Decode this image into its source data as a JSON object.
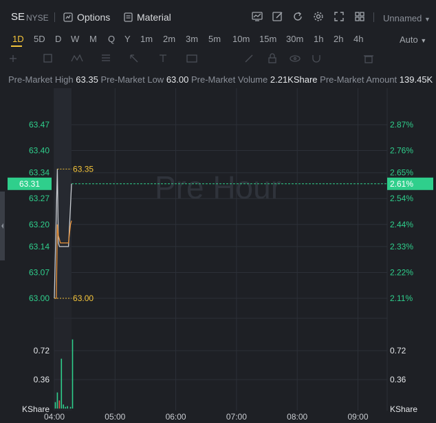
{
  "header": {
    "symbol": "SE",
    "exchange": "NYSE",
    "options_label": "Options",
    "material_label": "Material",
    "layout_name": "Unnamed"
  },
  "periods": [
    "1D",
    "5D",
    "D",
    "W",
    "M",
    "Q",
    "Y",
    "1m",
    "2m",
    "3m",
    "5m",
    "10m",
    "15m",
    "30m",
    "1h",
    "2h",
    "4h"
  ],
  "active_period": "1D",
  "scale_mode": "Auto",
  "stats": {
    "high_label": "Pre-Market High",
    "high_value": "63.35",
    "low_label": "Pre-Market Low",
    "low_value": "63.00",
    "volume_label": "Pre-Market Volume",
    "volume_value": "2.21KShare",
    "amount_label": "Pre-Market Amount",
    "amount_value": "139.45K"
  },
  "colors": {
    "up": "#2fcf8c",
    "price_line": "#c9ccd1",
    "avg_line": "#e8923a",
    "hl_marker": "#f5c53b",
    "grid": "#2c3038",
    "background": "#1e2025"
  },
  "chart_data": {
    "type": "line",
    "watermark": "Pre Hour",
    "x_ticks": [
      "04:00",
      "05:00",
      "06:00",
      "07:00",
      "08:00",
      "09:00"
    ],
    "y_ticks_price": [
      "63.47",
      "63.40",
      "63.34",
      "63.27",
      "63.20",
      "63.14",
      "63.07",
      "63.00"
    ],
    "y_ticks_pct": [
      "2.87%",
      "2.76%",
      "2.65%",
      "2.54%",
      "2.44%",
      "2.33%",
      "2.22%",
      "2.11%"
    ],
    "ylim": [
      63.0,
      63.47
    ],
    "current_price": "63.31",
    "current_pct": "2.61%",
    "high_marker": "63.35",
    "low_marker": "63.00",
    "series": [
      {
        "values_x": [
          0,
          3,
          4,
          5,
          7,
          9,
          11,
          14,
          16,
          17
        ],
        "values_y": [
          63.0,
          63.35,
          63.15,
          63.14,
          63.14,
          63.14,
          63.14,
          63.14,
          63.25,
          63.31
        ]
      },
      {
        "values_x": [
          0,
          2,
          3,
          4,
          6,
          8,
          10,
          12,
          14,
          16,
          17
        ],
        "values_y": [
          63.0,
          63.0,
          63.2,
          63.17,
          63.15,
          63.15,
          63.15,
          63.15,
          63.15,
          63.2,
          63.21
        ]
      }
    ],
    "volume": {
      "y_ticks": [
        "0.72",
        "0.36"
      ],
      "unit_label": "KShare",
      "bars_x": [
        1,
        3,
        5,
        7,
        9,
        11,
        13,
        16,
        18
      ],
      "values": [
        0.08,
        0.2,
        0.1,
        0.62,
        0.05,
        0.02,
        0.03,
        0.02,
        0.86
      ]
    }
  }
}
